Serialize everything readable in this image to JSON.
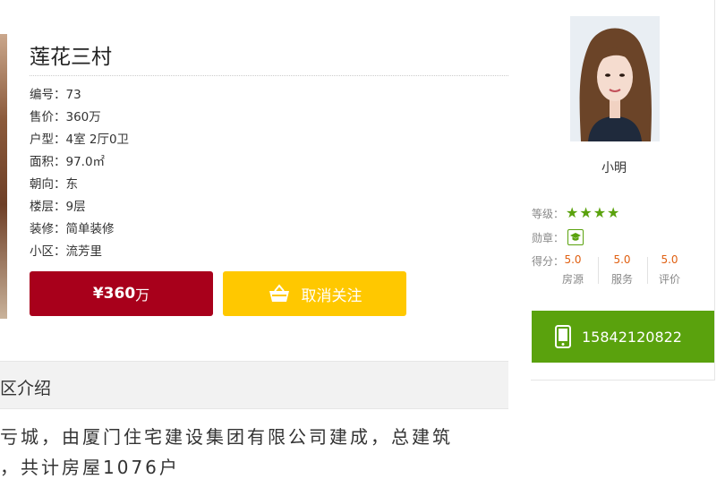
{
  "listing": {
    "title": "莲花三村",
    "specs": [
      {
        "label": "编号：",
        "value": "73"
      },
      {
        "label": "售价：",
        "value": "360万"
      },
      {
        "label": "户型：",
        "value": "4室 2厅0卫"
      },
      {
        "label": "面积：",
        "value": "97.0㎡"
      },
      {
        "label": "朝向：",
        "value": "东"
      },
      {
        "label": "楼层：",
        "value": "9层"
      },
      {
        "label": "装修：",
        "value": "简单装修"
      },
      {
        "label": "小区：",
        "value": "流芳里"
      }
    ],
    "price_button": {
      "amount": "¥360",
      "unit": "万"
    },
    "favorite_button": {
      "label": "取消关注",
      "icon": "basket-icon"
    }
  },
  "community": {
    "section_title": "区介绍",
    "intro_line1": "亏城，由厦门住宅建设集团有限公司建成，总建筑",
    "intro_line2": "，共计房屋1076户"
  },
  "agent": {
    "name": "小明",
    "level_label": "等级：",
    "stars": "★★★★",
    "level_stars": 4.2,
    "medal_label": "勋章：",
    "medal_icon": "graduation-cap-icon",
    "score_label": "得分：",
    "scores": [
      {
        "value": "5.0",
        "name": "房源"
      },
      {
        "value": "5.0",
        "name": "服务"
      },
      {
        "value": "5.0",
        "name": "评价"
      }
    ],
    "phone": "15842120822",
    "phone_icon": "mobile-phone-icon"
  },
  "colors": {
    "price_red": "#a8001b",
    "favorite_yellow": "#ffc800",
    "agent_green": "#5aa20d",
    "score_orange": "#e05f10"
  }
}
